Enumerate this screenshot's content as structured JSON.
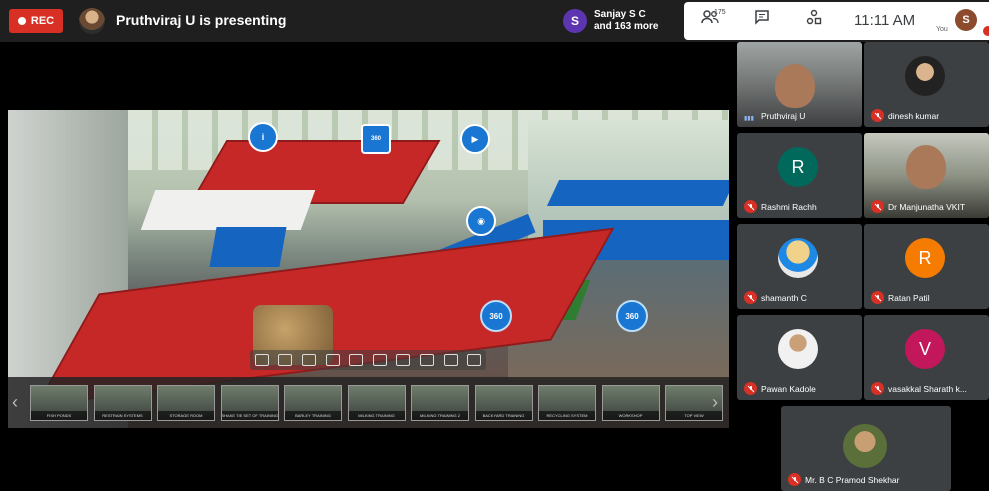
{
  "topbar": {
    "rec_label": "REC",
    "presenting_text": "Pruthviraj U is presenting",
    "chip_initial": "S",
    "chip_line1": "Sanjay S C",
    "chip_line2": "and 163 more",
    "participant_count": "175",
    "time": "11:11 AM",
    "self_initial": "S",
    "self_label": "You"
  },
  "colors": {
    "rec_red": "#d93025",
    "accent_blue": "#1976d2",
    "tile_bg": "#3c4043"
  },
  "viewer": {
    "hotspot_360": "360",
    "thumbnails": [
      {
        "caption": "FISH PONDS"
      },
      {
        "caption": "RESTRAIN SYSTEMS"
      },
      {
        "caption": "STORAGE ROOM"
      },
      {
        "caption": "SHAKE TIE SET OF TRAINING"
      },
      {
        "caption": "BARLEY TRAINING"
      },
      {
        "caption": "MILKING TRAINING"
      },
      {
        "caption": "MILKING TRAINING 2"
      },
      {
        "caption": "BACKYARD TRAINING"
      },
      {
        "caption": "RECYCLING SYSTEM"
      },
      {
        "caption": "WORKSHOP"
      },
      {
        "caption": "TOP VIEW"
      }
    ]
  },
  "participants": [
    {
      "name": "Pruthviraj U",
      "type": "video",
      "speaking": true
    },
    {
      "name": "dinesh kumar",
      "type": "photo"
    },
    {
      "name": "Rashmi Rachh",
      "type": "letter",
      "initial": "R",
      "color": "#00695c"
    },
    {
      "name": "Dr Manjunatha VKIT",
      "type": "video"
    },
    {
      "name": "shamanth C",
      "type": "photo"
    },
    {
      "name": "Ratan Patil",
      "type": "letter",
      "initial": "R",
      "color": "#f57c00"
    },
    {
      "name": "Pawan Kadole",
      "type": "photo"
    },
    {
      "name": "vasakkal Sharath k...",
      "type": "letter",
      "initial": "V",
      "color": "#c2185b"
    },
    {
      "name": "Mr. B C Pramod Shekhar",
      "type": "photo"
    }
  ]
}
